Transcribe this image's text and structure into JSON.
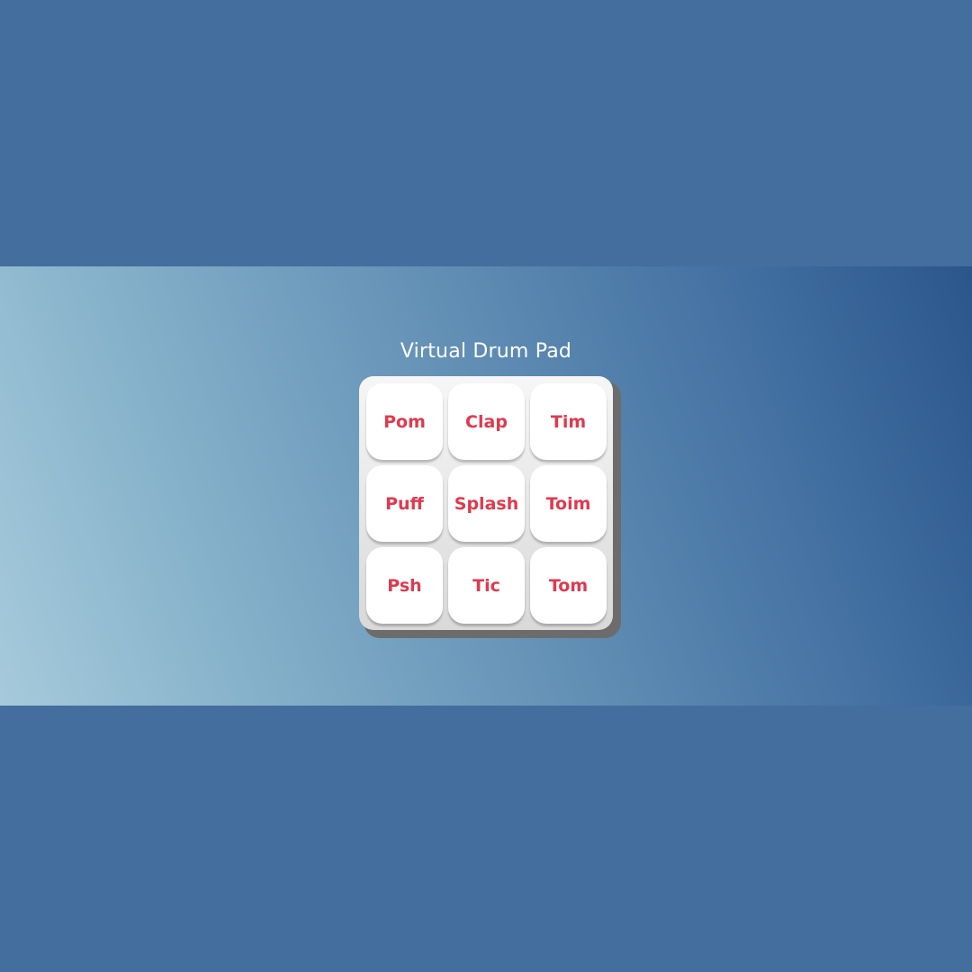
{
  "app": {
    "title": "Virtual Drum Pad"
  },
  "pads": [
    {
      "label": "Pom"
    },
    {
      "label": "Clap"
    },
    {
      "label": "Tim"
    },
    {
      "label": "Puff"
    },
    {
      "label": "Splash"
    },
    {
      "label": "Toim"
    },
    {
      "label": "Psh"
    },
    {
      "label": "Tic"
    },
    {
      "label": "Tom"
    }
  ],
  "colors": {
    "page_background": "#436e9e",
    "pad_label": "#e0394e",
    "pad_face": "#ffffff",
    "board": "#e6e6e6",
    "board_shadow": "#6c6c6c",
    "title": "#ffffff"
  }
}
